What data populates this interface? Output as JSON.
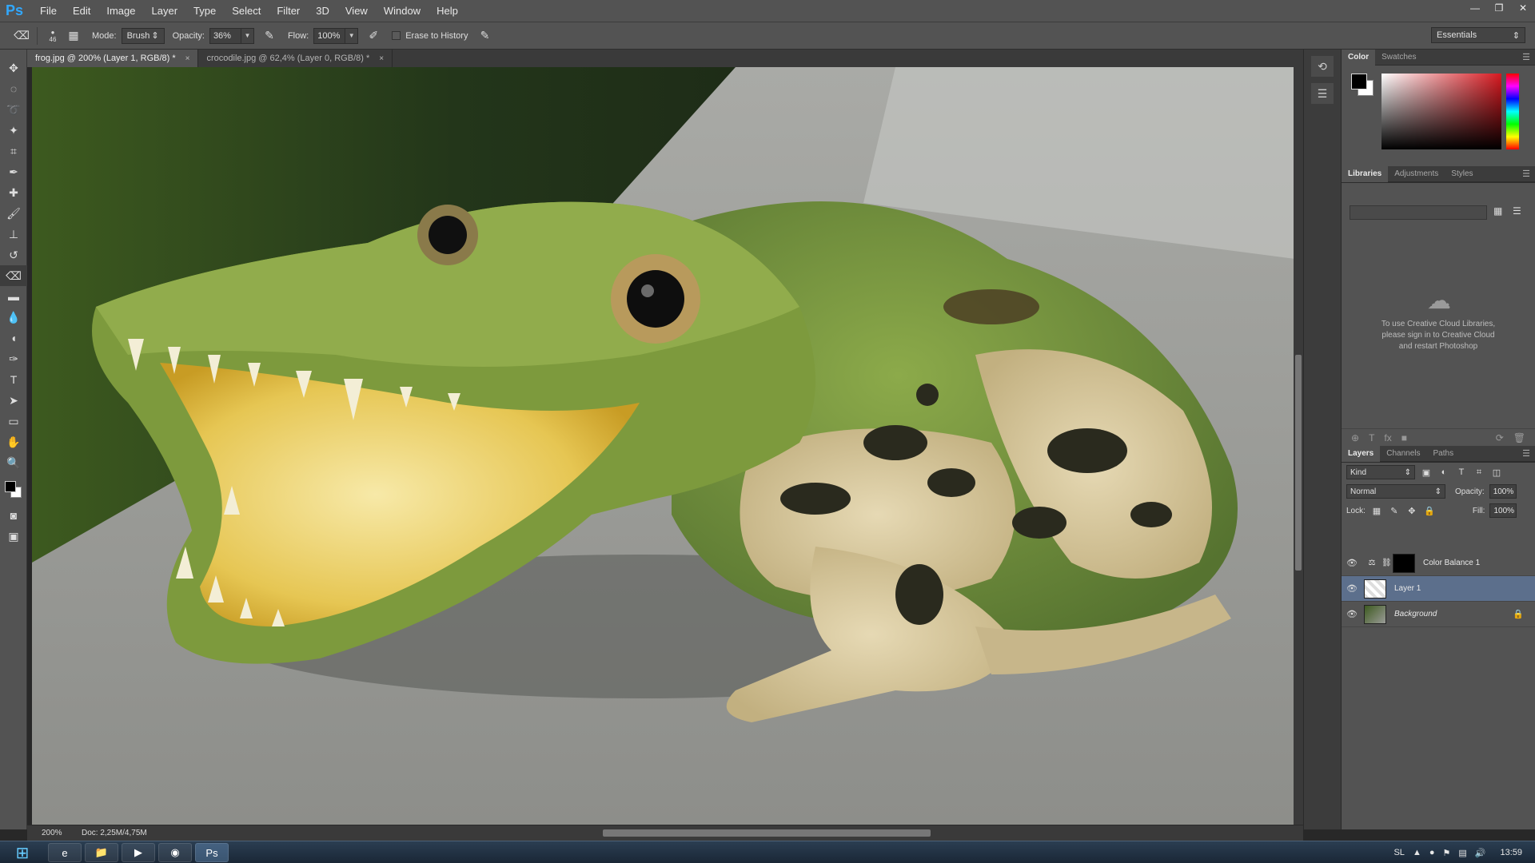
{
  "app": {
    "logo": "Ps",
    "menu": [
      "File",
      "Edit",
      "Image",
      "Layer",
      "Type",
      "Select",
      "Filter",
      "3D",
      "View",
      "Window",
      "Help"
    ],
    "window_controls": [
      "—",
      "❐",
      "✕"
    ]
  },
  "options": {
    "brush_size": "46",
    "mode_label": "Mode:",
    "mode_value": "Brush",
    "opacity_label": "Opacity:",
    "opacity_value": "36%",
    "flow_label": "Flow:",
    "flow_value": "100%",
    "erase_history_label": "Erase to History",
    "workspace": "Essentials"
  },
  "tabs": [
    {
      "title": "frog.jpg @ 200% (Layer 1, RGB/8) *",
      "close": "×"
    },
    {
      "title": "crocodile.jpg @ 62,4% (Layer 0, RGB/8) *",
      "close": "×"
    }
  ],
  "status": {
    "zoom": "200%",
    "doc": "Doc: 2,25M/4,75M"
  },
  "panels": {
    "color_tabs": [
      "Color",
      "Swatches"
    ],
    "library_tabs": [
      "Libraries",
      "Adjustments",
      "Styles"
    ],
    "library_message": "To use Creative Cloud Libraries,\nplease sign in to Creative Cloud\nand restart Photoshop",
    "layer_tabs": [
      "Layers",
      "Channels",
      "Paths"
    ],
    "kind_filter": "Kind",
    "blend_mode": "Normal",
    "opacity_label": "Opacity:",
    "opacity_value": "100%",
    "lock_label": "Lock:",
    "fill_label": "Fill:",
    "fill_value": "100%"
  },
  "layers": [
    {
      "name": "Color Balance 1",
      "selected": false
    },
    {
      "name": "Layer 1",
      "selected": true
    },
    {
      "name": "Background",
      "selected": false,
      "locked": true
    }
  ],
  "tray": {
    "language": "SL",
    "time": "13:59"
  },
  "colors": {
    "accent": "#31a8ff",
    "selected_layer": "#5c6f8c",
    "panel_bg": "#535353"
  }
}
